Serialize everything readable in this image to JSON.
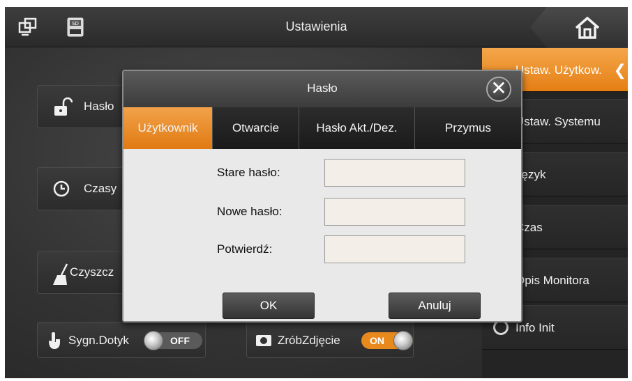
{
  "topbar": {
    "title": "Ustawienia",
    "icons": [
      "screen-icon",
      "sd-card-icon",
      "home-icon"
    ]
  },
  "right_menu": {
    "items": [
      {
        "label": "Ustaw. Użytkow.",
        "active": true,
        "icon": "gear-icon"
      },
      {
        "label": "Ustaw. Systemu",
        "active": false
      },
      {
        "label": "Język",
        "active": false
      },
      {
        "label": "Czas",
        "active": false
      },
      {
        "label": "Opis Monitora",
        "active": false
      },
      {
        "label": "Info Init",
        "active": false,
        "icon": "circle-icon"
      }
    ],
    "accent": "#e8841c"
  },
  "cards": {
    "password": {
      "label": "Hasło",
      "icon": "padlock-icon"
    },
    "time": {
      "label": "Czasy",
      "icon": "clock-icon"
    },
    "clean": {
      "label": "Czyszcz",
      "icon": "broom-icon"
    }
  },
  "bottom": {
    "touch_sound": {
      "label": "Sygn.Dotyk",
      "state": "OFF",
      "icon": "touch-hand-icon"
    },
    "snapshot": {
      "label": "ZróbZdjęcie",
      "state": "ON",
      "icon": "camera-icon"
    }
  },
  "dialog": {
    "title": "Hasło",
    "tabs": [
      {
        "label": "Użytkownik",
        "active": true
      },
      {
        "label": "Otwarcie",
        "active": false
      },
      {
        "label": "Hasło Akt./Dez.",
        "active": false
      },
      {
        "label": "Przymus",
        "active": false
      }
    ],
    "fields": {
      "old_password": {
        "label": "Stare hasło:",
        "value": ""
      },
      "new_password": {
        "label": "Nowe hasło:",
        "value": ""
      },
      "confirm": {
        "label": "Potwierdź:",
        "value": ""
      }
    },
    "ok_label": "OK",
    "cancel_label": "Anuluj"
  }
}
